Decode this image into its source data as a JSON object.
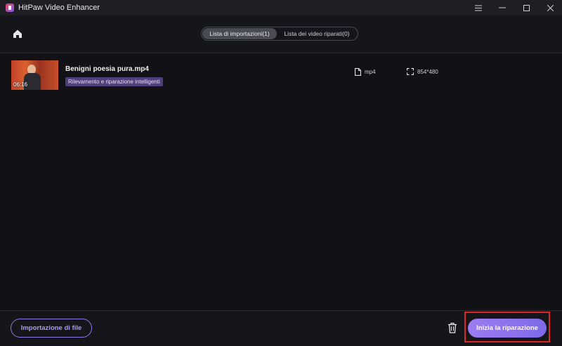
{
  "window": {
    "title": "HitPaw Video Enhancer",
    "controls": [
      "menu-icon",
      "minimize-icon",
      "maximize-icon",
      "close-icon"
    ]
  },
  "header": {
    "home_icon": "home-icon",
    "tabs": [
      {
        "label": "Lista di importazioni(1)",
        "active": true
      },
      {
        "label": "Lista dei video riparati(0)",
        "active": false
      }
    ]
  },
  "files": [
    {
      "name": "Benigni poesia pura.mp4",
      "duration": "06:16",
      "mode": "Rilevamento e riparazione intelligenti",
      "format": "mp4",
      "resolution": "854*480"
    }
  ],
  "footer": {
    "import_label": "Importazione di file",
    "delete_icon": "trash-icon",
    "start_label": "Inizia la riparazione"
  },
  "colors": {
    "accent": "#8b7ae6",
    "badge": "#4d3f7a",
    "highlight": "#e02424",
    "background": "#121216"
  }
}
